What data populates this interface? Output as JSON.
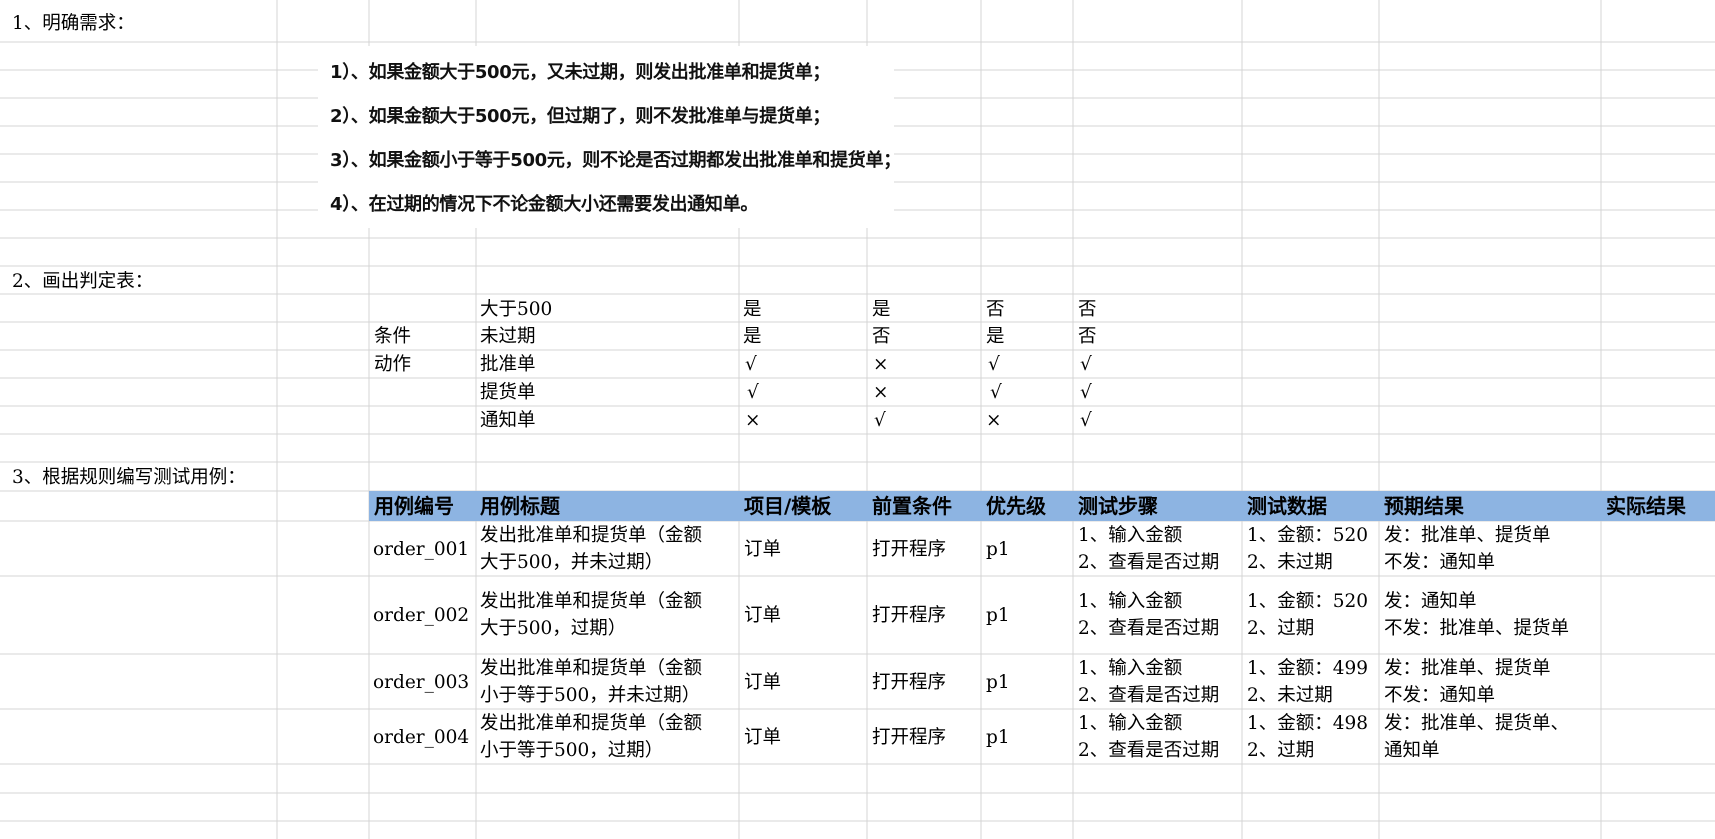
{
  "sections": {
    "s1": "1、明确需求：",
    "s2": "2、画出判定表：",
    "s3": "3、根据规则编写测试用例："
  },
  "requirements": [
    "1）、如果金额大于500元，又未过期，则发出批准单和提货单；",
    "2）、如果金额大于500元，但过期了，则不发批准单与提货单；",
    "3）、如果金额小于等于500元，则不论是否过期都发出批准单和提货单；",
    "4）、在过期的情况下不论金额大小还需要发出通知单。"
  ],
  "decision_table": {
    "group_condition": "条件",
    "group_action": "动作",
    "rows": [
      {
        "label": "大于500",
        "values": [
          "是",
          "是",
          "否",
          "否"
        ]
      },
      {
        "label": "未过期",
        "values": [
          "是",
          "否",
          "是",
          "否"
        ]
      },
      {
        "label": "批准单",
        "values": [
          "√",
          "×",
          "√",
          "√"
        ]
      },
      {
        "label": "提货单",
        "values": [
          "√",
          "×",
          "√",
          "√"
        ]
      },
      {
        "label": "通知单",
        "values": [
          "×",
          "√",
          "×",
          "√"
        ]
      }
    ]
  },
  "test_cases": {
    "headers": [
      "用例编号",
      "用例标题",
      "项目/模板",
      "前置条件",
      "优先级",
      "测试步骤",
      "测试数据",
      "预期结果",
      "实际结果"
    ],
    "rows": [
      {
        "id": "order_001",
        "title": [
          "发出批准单和提货单（金额",
          "大于500，并未过期）"
        ],
        "module": "订单",
        "precondition": "打开程序",
        "priority": "p1",
        "steps": [
          "1、输入金额",
          "2、查看是否过期"
        ],
        "data": [
          "1、金额：520",
          "2、未过期"
        ],
        "expected": [
          "发：批准单、提货单",
          "不发：通知单"
        ],
        "actual": ""
      },
      {
        "id": "order_002",
        "title": [
          "发出批准单和提货单（金额",
          "大于500，过期）"
        ],
        "module": "订单",
        "precondition": "打开程序",
        "priority": "p1",
        "steps": [
          "1、输入金额",
          "2、查看是否过期"
        ],
        "data": [
          "1、金额：520",
          "2、过期"
        ],
        "expected": [
          "发：通知单",
          "不发：批准单、提货单"
        ],
        "actual": ""
      },
      {
        "id": "order_003",
        "title": [
          "发出批准单和提货单（金额",
          "小于等于500，并未过期）"
        ],
        "module": "订单",
        "precondition": "打开程序",
        "priority": "p1",
        "steps": [
          "1、输入金额",
          "2、查看是否过期"
        ],
        "data": [
          "1、金额：499",
          "2、未过期"
        ],
        "expected": [
          "发：批准单、提货单",
          "不发：通知单"
        ],
        "actual": ""
      },
      {
        "id": "order_004",
        "title": [
          "发出批准单和提货单（金额",
          "小于等于500，过期）"
        ],
        "module": "订单",
        "precondition": "打开程序",
        "priority": "p1",
        "steps": [
          "1、输入金额",
          "2、查看是否过期"
        ],
        "data": [
          "1、金额：498",
          "2、过期"
        ],
        "expected": [
          "发：批准单、提货单、",
          "通知单"
        ],
        "actual": ""
      }
    ]
  },
  "colors": {
    "gridline": "#d4d4d4",
    "header_band": "#8db4e2"
  }
}
